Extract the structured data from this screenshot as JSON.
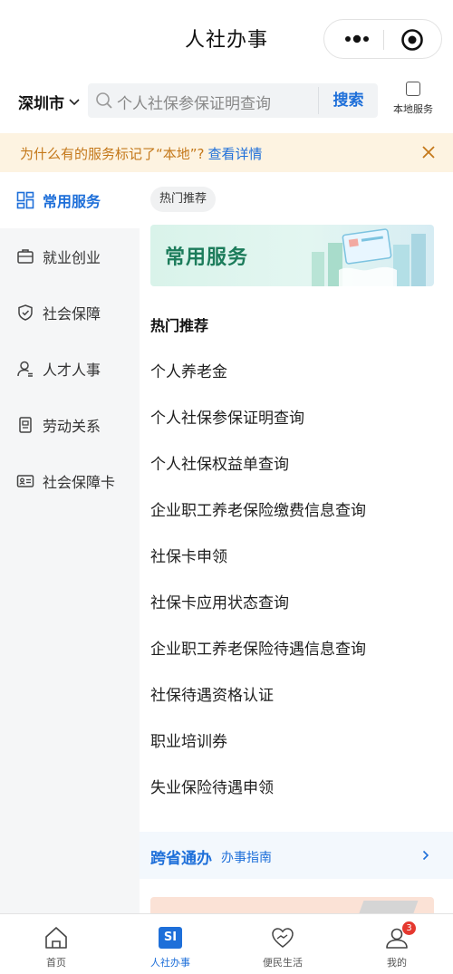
{
  "header": {
    "title": "人社办事"
  },
  "search": {
    "city": "深圳市",
    "placeholder": "个人社保参保证明查询",
    "button": "搜索",
    "local_service": "本地服务"
  },
  "notice": {
    "text": "为什么有的服务标记了“本地”?",
    "link": "查看详情"
  },
  "sidebar": {
    "items": [
      {
        "label": "常用服务",
        "icon": "grid-icon"
      },
      {
        "label": "就业创业",
        "icon": "briefcase-icon"
      },
      {
        "label": "社会保障",
        "icon": "shield-icon"
      },
      {
        "label": "人才人事",
        "icon": "person-icon"
      },
      {
        "label": "劳动关系",
        "icon": "document-icon"
      },
      {
        "label": "社会保障卡",
        "icon": "id-card-icon"
      }
    ]
  },
  "main": {
    "tag": "热门推荐",
    "banner_title": "常用服务",
    "section_title": "热门推荐",
    "services": [
      "个人养老金",
      "个人社保参保证明查询",
      "个人社保权益单查询",
      "企业职工养老保险缴费信息查询",
      "社保卡申领",
      "社保卡应用状态查询",
      "企业职工养老保险待遇信息查询",
      "社保待遇资格认证",
      "职业培训券",
      "失业保险待遇申领"
    ],
    "cross_title": "跨省通办",
    "cross_sub": "办事指南"
  },
  "tabbar": {
    "tabs": [
      {
        "label": "首页",
        "icon": "home-icon"
      },
      {
        "label": "人社办事",
        "icon": "si-icon",
        "icon_text": "SI"
      },
      {
        "label": "便民生活",
        "icon": "heart-hand-icon"
      },
      {
        "label": "我的",
        "icon": "profile-icon",
        "badge": "3"
      }
    ]
  },
  "colors": {
    "accent": "#1e6fd9",
    "notice_bg": "#fdf3e1",
    "notice_text": "#c4781a",
    "badge": "#e5382f"
  }
}
